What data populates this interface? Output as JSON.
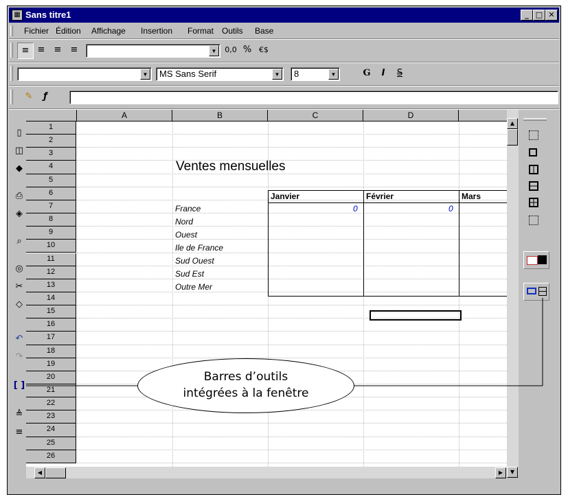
{
  "window": {
    "title": "Sans titre1",
    "min": "_",
    "max": "□",
    "close": "✕"
  },
  "menu": [
    "Fichier",
    "Édition",
    "Affichage",
    "Insertion",
    "Format",
    "Outils",
    "Base"
  ],
  "toolbar1": {
    "numformat": "0,0",
    "percent": "%",
    "currency": "€$"
  },
  "toolbar2": {
    "font": "MS Sans Serif",
    "size": "8",
    "bold": "G",
    "italic": "I",
    "strike": "S"
  },
  "columns": [
    "A",
    "B",
    "C",
    "D"
  ],
  "rows": [
    "1",
    "2",
    "3",
    "4",
    "5",
    "6",
    "7",
    "8",
    "9",
    "10",
    "11",
    "12",
    "13",
    "14",
    "15",
    "16",
    "17",
    "18",
    "19",
    "20",
    "21",
    "22",
    "23",
    "24",
    "25",
    "26"
  ],
  "sheet": {
    "title": "Ventes mensuelles",
    "months": [
      "Janvier",
      "Février",
      "Mars"
    ],
    "regions": [
      "France",
      "Nord",
      "Ouest",
      "Ile de France",
      "Sud Ouest",
      "Sud Est",
      "Outre Mer"
    ],
    "france_values": [
      "0",
      "0"
    ]
  },
  "callout": {
    "line1": "Barres d’outils",
    "line2": "intégrées à la fenêtre"
  }
}
